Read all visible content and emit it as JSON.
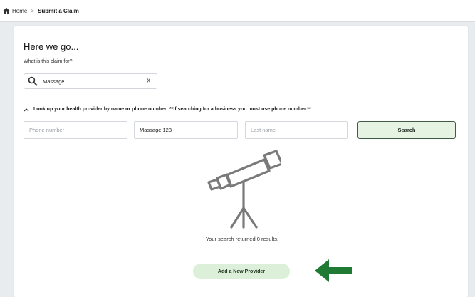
{
  "breadcrumb": {
    "home_icon": "home-icon",
    "home": "Home",
    "separator": ">",
    "current": "Submit a Claim"
  },
  "heading": {
    "title": "Here we go...",
    "subtitle": "What is this claim for?"
  },
  "claim_search": {
    "icon": "search-icon",
    "value": "Massage",
    "clear_label": "X"
  },
  "lookup": {
    "icon": "chevron-up-icon",
    "label": "Look up your health provider by name or phone number: **If searching for a business you must use phone number.**"
  },
  "fields": {
    "phone": {
      "placeholder": "Phone number",
      "value": ""
    },
    "provider": {
      "placeholder": "",
      "value": "Massage 123"
    },
    "last_name": {
      "placeholder": "Last name",
      "value": ""
    }
  },
  "search_button": "Search",
  "results": {
    "illustration": "telescope-icon",
    "message": "Your search returned 0 results."
  },
  "add_provider_button": "Add a New Provider",
  "annotation": {
    "icon": "arrow-left-icon",
    "color": "#1f7a34"
  },
  "colors": {
    "accent_green": "#1f7a34",
    "button_fill": "#e7f3e2",
    "add_button_fill": "#dcefd9",
    "page_bg": "#e9ecef"
  }
}
